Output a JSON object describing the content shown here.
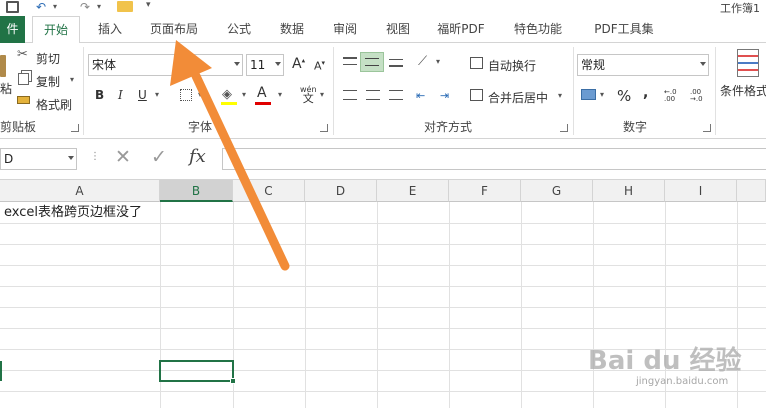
{
  "window": {
    "title": "工作簿1"
  },
  "tabs": [
    "件",
    "开始",
    "插入",
    "页面布局",
    "公式",
    "数据",
    "审阅",
    "视图",
    "福昕PDF",
    "特色功能",
    "PDF工具集"
  ],
  "clipboard": {
    "cut": "剪切",
    "copy": "复制",
    "format_painter": "格式刷",
    "paste_fragment": "粘",
    "group_label": "剪贴板"
  },
  "font": {
    "name": "宋体",
    "size": "11",
    "bold": "B",
    "italic": "I",
    "underline": "U",
    "wen_label": "wén",
    "wen_char": "文",
    "group_label": "字体"
  },
  "alignment": {
    "wrap_text": "自动换行",
    "merge_center": "合并后居中",
    "group_label": "对齐方式"
  },
  "number": {
    "format": "常规",
    "percent": "%",
    "comma": ",",
    "group_label": "数字"
  },
  "styles": {
    "conditional_format": "条件格式"
  },
  "formula_bar": {
    "name_box": "D",
    "fx": "fx",
    "content": ""
  },
  "columns": [
    "A",
    "B",
    "C",
    "D",
    "E",
    "F",
    "G",
    "H",
    "I"
  ],
  "cells": {
    "A1": "excel表格跨页边框没了"
  },
  "watermark": {
    "brand": "Bai du 经验",
    "url": "jingyan.baidu.com"
  },
  "colors": {
    "excel_green": "#217346",
    "arrow": "#f28c38",
    "selected_column": "#d2d2d2"
  }
}
